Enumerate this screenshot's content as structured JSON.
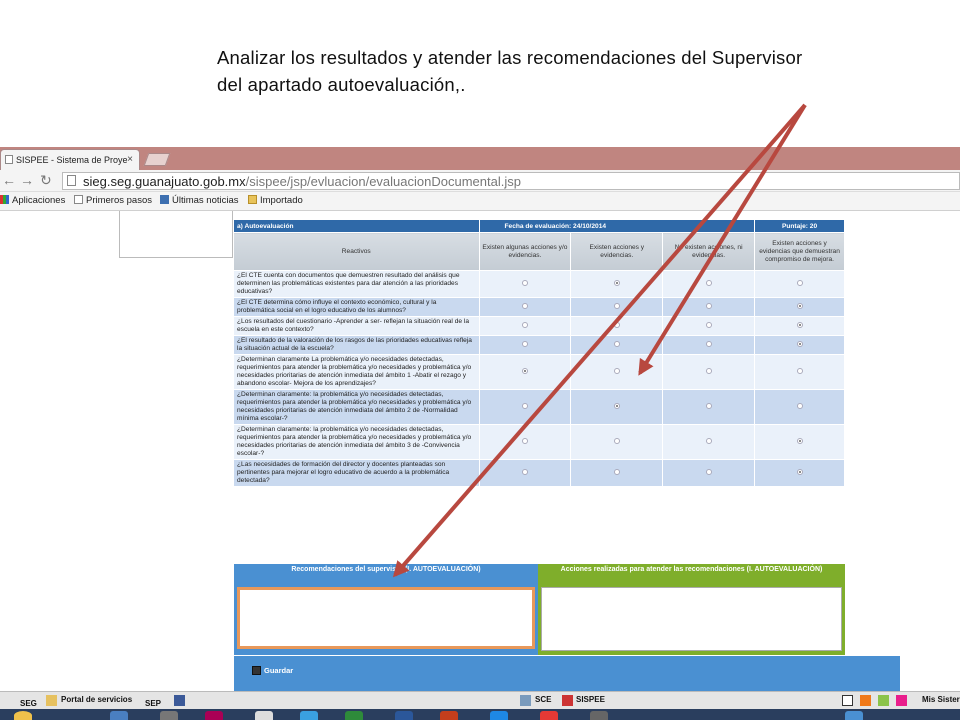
{
  "caption": {
    "line1": "Analizar los resultados y atender las recomendaciones del Supervisor",
    "line2": "del apartado autoevaluación,."
  },
  "browser": {
    "tab_title": "SISPEE - Sistema de Proye",
    "tab_close": "×",
    "url_host": "sieg.seg.guanajuato.gob.mx",
    "url_path": "/sispee/jsp/evluacion/evaluacionDocumental.jsp",
    "bookmarks": [
      "Aplicaciones",
      "Primeros pasos",
      "Últimas noticias",
      "Importado"
    ]
  },
  "autoevaluacion": {
    "title": "a) Autoevaluación",
    "fecha": "Fecha de evaluación: 24/10/2014",
    "puntaje": "Puntaje: 20",
    "columns": [
      "Reactivos",
      "Existen algunas acciones y/o evidencias.",
      "Existen acciones y evidencias.",
      "No existen acciones, ni evidencias.",
      "Existen acciones y evidencias que demuestran compromiso de mejora."
    ],
    "rows": [
      {
        "q": "¿El CTE cuenta con documentos que demuestren resultado del análisis que determinen las problemáticas existentes para dar atención a las prioridades educativas?",
        "selected": 1
      },
      {
        "q": "¿El CTE determina cómo influye el contexto económico, cultural y la problemática social en el logro educativo de los alumnos?",
        "selected": 3
      },
      {
        "q": "¿Los resultados del cuestionario -Aprender a ser- reflejan la situación real de la escuela en este contexto?",
        "selected": 3
      },
      {
        "q": "¿El resultado de la valoración de los rasgos de las prioridades educativas refleja la situación actual de la escuela?",
        "selected": 3
      },
      {
        "q": "¿Determinan claramente La problemática y/o necesidades detectadas, requerimientos para atender la problemática y/o necesidades y problemática y/o necesidades prioritarias de atención inmediata del ámbito 1 -Abatir el rezago y abandono escolar- Mejora de los aprendizajes?",
        "selected": 0
      },
      {
        "q": "¿Determinan claramente: la problemática y/o necesidades detectadas, requerimientos para atender la problemática y/o necesidades y problemática y/o necesidades prioritarias de atención inmediata del ámbito 2 de -Normalidad mínima escolar-?",
        "selected": 1
      },
      {
        "q": "¿Determinan claramente: la problemática y/o necesidades detectadas, requerimientos para atender la problemática y/o necesidades y problemática y/o necesidades prioritarias de atención inmediata del ámbito 3 de -Convivencia escolar-?",
        "selected": 3
      },
      {
        "q": "¿Las necesidades de formación del director y docentes planteadas son pertinentes para mejorar el logro educativo de acuerdo a la problemática detectada?",
        "selected": 3
      }
    ]
  },
  "recomendaciones": {
    "left_header": "Recomendaciones del supervisor (I. AUTOEVALUACIÓN)",
    "right_header": "Acciones realizadas para atender las recomendaciones (I. AUTOEVALUACIÓN)",
    "left_value": "",
    "right_value": ""
  },
  "save_label": "Guardar",
  "taskbar": {
    "seg": "SEG",
    "portal": "Portal de servicios",
    "sep": "SEP",
    "sce": "SCE",
    "sispee": "SISPEE",
    "mis": "Mis Sister"
  },
  "colors": {
    "header_blue": "#2f69a8",
    "reco_blue": "#4a90d2",
    "reco_green": "#7fae2b",
    "arrow_red": "#b8483f"
  }
}
